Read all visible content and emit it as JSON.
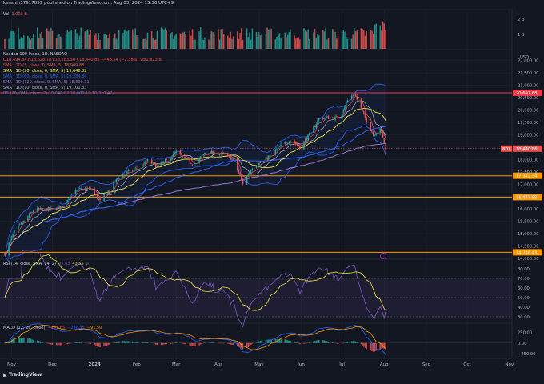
{
  "header": {
    "publisher": "kenshin57917859 published on TradingView.com, Aug 03, 2024 15:36 UTC+9"
  },
  "brand": {
    "name": "TradingView"
  },
  "volume_panel": {
    "label": "Vol",
    "value": "1.003 B",
    "ticks": [
      "2 B",
      "1 B"
    ],
    "color_up": "#26a69a",
    "color_down": "#ef5350"
  },
  "price_panel": {
    "legend": [
      {
        "text": "Nasdaq 100 Index, 1D, NASDAQ",
        "color": "#d1d4dc"
      },
      {
        "text": "O18,494.34 H18,628.78 L18,283.50 C18,440.86 −448.54 (−2.38%) Vol1.823 B",
        "color": "#ef5350"
      },
      {
        "text": "SMA · 1D (5, close, 0, SMA, 5)  18,909.88",
        "color": "#ef5350"
      },
      {
        "text": "SMA · 1D (20, close, 0, SMA, 5)  19,646.82",
        "color": "#f0e442"
      },
      {
        "text": "SMA · 1D (60, close, 0, SMA, 5)  19,284.84",
        "color": "#2962ff"
      },
      {
        "text": "SMA · 1D (120, close, 0, SMA, 5)  18,800.31",
        "color": "#9575cd"
      },
      {
        "text": "SMA · 1D (10, close, 0, SMA, 5)  19,101.33",
        "color": "#b2b5be"
      },
      {
        "text": "BB (20, SMA, close, 2)  19,646.82  20,983.17  18,310.47",
        "color": "#5c6bc0"
      }
    ],
    "currency": "USD",
    "price_ticks": [
      "22,000.00",
      "21,500.00",
      "21,000.00",
      "20,500.00",
      "20,000.00",
      "19,500.00",
      "19,000.00",
      "18,500.00",
      "18,000.00",
      "17,500.00",
      "17,000.00",
      "16,500.00",
      "16,000.00",
      "15,500.00",
      "15,000.00",
      "14,500.00",
      "14,000.00"
    ],
    "ndx_tag": "NDX",
    "last_price": "18,440.86",
    "levels": [
      {
        "value": 20697.68,
        "label": "20,697.68",
        "color": "#f23645"
      },
      {
        "value": 17342.34,
        "label": "17,342.34",
        "color": "#ff9800"
      },
      {
        "value": 16477.89,
        "label": "16,477.89",
        "color": "#ff9800"
      },
      {
        "value": 14246.43,
        "label": "14,246.43",
        "color": "#ff9800"
      }
    ]
  },
  "rsi_panel": {
    "legend": "RSI (14, close, SMA, 14, 2)",
    "value1": "35.43",
    "value2": "43.55",
    "ticks": [
      "80.00",
      "70.00",
      "60.00",
      "50.00",
      "40.00",
      "30.00"
    ]
  },
  "macd_panel": {
    "legend": "MACD (12, 26, close)",
    "value1": "−141.85",
    "value2": "−238.35",
    "value3": "−91.50",
    "ticks": [
      "250.00",
      "0.00",
      "−250.00"
    ]
  },
  "x_axis": {
    "labels": [
      "Nov",
      "Dec",
      "2024",
      "Feb",
      "Mar",
      "Apr",
      "May",
      "Jun",
      "Jul",
      "Aug",
      "Sep",
      "Oct",
      "Nov"
    ]
  },
  "chart_data": {
    "type": "candlestick",
    "title": "Nasdaq 100 Index, 1D, NASDAQ",
    "ylabel": "USD",
    "ylim": [
      14000,
      22250
    ],
    "x_labels": [
      "Nov",
      "Dec",
      "2024",
      "Feb",
      "Mar",
      "Apr",
      "May",
      "Jun",
      "Jul",
      "Aug",
      "Sep",
      "Oct",
      "Nov"
    ],
    "close_series": [
      {
        "date": "2023-10-27",
        "value": 14200
      },
      {
        "date": "2023-11-03",
        "value": 15100
      },
      {
        "date": "2023-11-10",
        "value": 15500
      },
      {
        "date": "2023-11-17",
        "value": 15950
      },
      {
        "date": "2023-11-24",
        "value": 15980
      },
      {
        "date": "2023-12-01",
        "value": 15990
      },
      {
        "date": "2023-12-08",
        "value": 16100
      },
      {
        "date": "2023-12-15",
        "value": 16620
      },
      {
        "date": "2023-12-22",
        "value": 16800
      },
      {
        "date": "2023-12-29",
        "value": 16820
      },
      {
        "date": "2024-01-05",
        "value": 16300
      },
      {
        "date": "2024-01-12",
        "value": 16800
      },
      {
        "date": "2024-01-19",
        "value": 17300
      },
      {
        "date": "2024-01-26",
        "value": 17500
      },
      {
        "date": "2024-02-02",
        "value": 17640
      },
      {
        "date": "2024-02-09",
        "value": 17950
      },
      {
        "date": "2024-02-16",
        "value": 17700
      },
      {
        "date": "2024-02-23",
        "value": 17950
      },
      {
        "date": "2024-03-01",
        "value": 18300
      },
      {
        "date": "2024-03-08",
        "value": 18000
      },
      {
        "date": "2024-03-15",
        "value": 17800
      },
      {
        "date": "2024-03-22",
        "value": 18300
      },
      {
        "date": "2024-03-29",
        "value": 18250
      },
      {
        "date": "2024-04-05",
        "value": 18200
      },
      {
        "date": "2024-04-12",
        "value": 18000
      },
      {
        "date": "2024-04-19",
        "value": 17040
      },
      {
        "date": "2024-04-26",
        "value": 17700
      },
      {
        "date": "2024-05-03",
        "value": 17900
      },
      {
        "date": "2024-05-10",
        "value": 18200
      },
      {
        "date": "2024-05-17",
        "value": 18550
      },
      {
        "date": "2024-05-24",
        "value": 18800
      },
      {
        "date": "2024-05-31",
        "value": 18500
      },
      {
        "date": "2024-06-07",
        "value": 19000
      },
      {
        "date": "2024-06-14",
        "value": 19650
      },
      {
        "date": "2024-06-21",
        "value": 19700
      },
      {
        "date": "2024-06-28",
        "value": 19680
      },
      {
        "date": "2024-07-05",
        "value": 20400
      },
      {
        "date": "2024-07-10",
        "value": 20680
      },
      {
        "date": "2024-07-17",
        "value": 19800
      },
      {
        "date": "2024-07-24",
        "value": 19000
      },
      {
        "date": "2024-07-29",
        "value": 19300
      },
      {
        "date": "2024-08-02",
        "value": 18440
      }
    ]
  }
}
